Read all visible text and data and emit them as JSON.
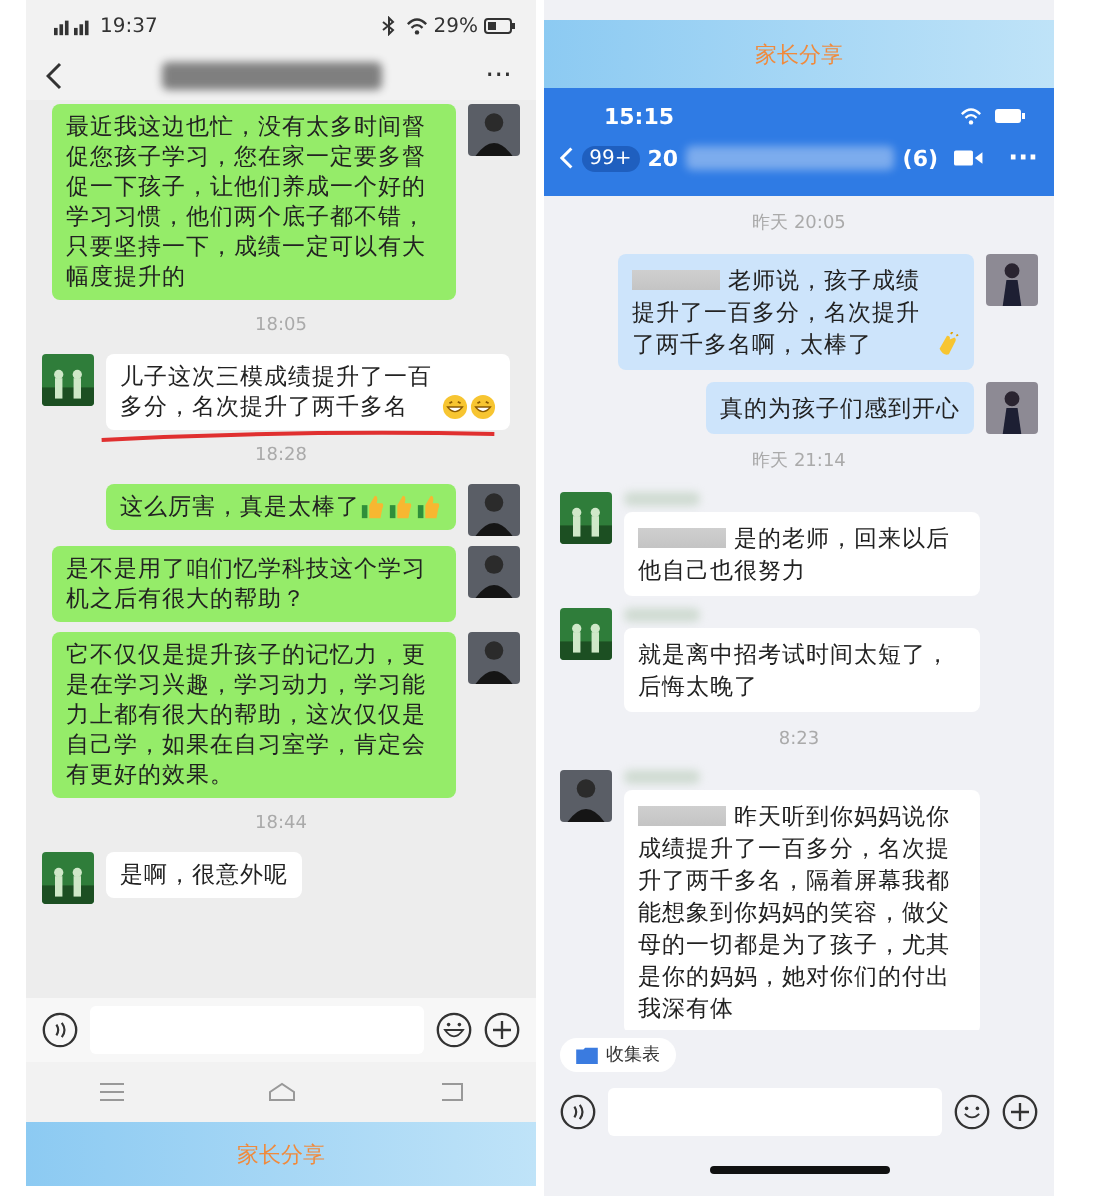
{
  "left_phone": {
    "status_bar": {
      "time": "19:37",
      "battery": "29%"
    },
    "header": {
      "more": "···"
    },
    "messages": [
      {
        "kind": "message",
        "outgoing": true,
        "avatar": {
          "kind": "suit"
        },
        "text": "最近我这边也忙，没有太多时间督促您孩子学习，您在家一定要多督促一下孩子，让他们养成一个好的学习习惯，他们两个底子都不错，只要坚持一下，成绩一定可以有大幅度提升的",
        "highlighted": false
      },
      {
        "kind": "time",
        "text": "18:05"
      },
      {
        "kind": "message",
        "outgoing": false,
        "avatar": {
          "kind": "scenery"
        },
        "text": "儿子这次三模成绩提升了一百多分，名次提升了两千多名",
        "emojis": [
          {
            "kind": "grin"
          },
          {
            "kind": "grin"
          }
        ],
        "highlighted": true
      },
      {
        "kind": "time",
        "text": "18:28"
      },
      {
        "kind": "message",
        "outgoing": true,
        "avatar": {
          "kind": "suit"
        },
        "text": "这么厉害，真是太棒了",
        "emojis": [
          {
            "kind": "thumbs-up"
          },
          {
            "kind": "thumbs-up"
          },
          {
            "kind": "thumbs-up"
          }
        ],
        "highlighted": false
      },
      {
        "kind": "message",
        "outgoing": true,
        "avatar": {
          "kind": "suit"
        },
        "text": "是不是用了咱们忆学科技这个学习机之后有很大的帮助？",
        "highlighted": false
      },
      {
        "kind": "message",
        "outgoing": true,
        "avatar": {
          "kind": "suit"
        },
        "text": "它不仅仅是提升孩子的记忆力，更是在学习兴趣，学习动力，学习能力上都有很大的帮助，这次仅仅是自己学，如果在自习室学，肯定会有更好的效果。",
        "highlighted": false
      },
      {
        "kind": "time",
        "text": "18:44"
      },
      {
        "kind": "message",
        "outgoing": false,
        "avatar": {
          "kind": "scenery"
        },
        "text": "是啊，很意外呢",
        "highlighted": false
      }
    ],
    "banner": "家长分享"
  },
  "right_phone": {
    "banner": "家长分享",
    "status_bar": {
      "time": "15:15"
    },
    "header": {
      "unread": "99+",
      "title": "20",
      "member_count": "(6)",
      "more": "···"
    },
    "messages": [
      {
        "kind": "time",
        "text": "昨天 20:05"
      },
      {
        "kind": "message",
        "outgoing": true,
        "avatar": {
          "kind": "woman"
        },
        "sender_blurred": false,
        "blurred_prefix": true,
        "text": "老师说，孩子成绩提升了一百多分，名次提升了两千多名啊，太棒了",
        "emojis": [
          {
            "kind": "clap"
          }
        ]
      },
      {
        "kind": "message",
        "outgoing": true,
        "avatar": {
          "kind": "woman"
        },
        "sender_blurred": false,
        "blurred_prefix": false,
        "text": "真的为孩子们感到开心"
      },
      {
        "kind": "time",
        "text": "昨天 21:14"
      },
      {
        "kind": "message",
        "outgoing": false,
        "avatar": {
          "kind": "scenery"
        },
        "sender_blurred": true,
        "blurred_prefix": true,
        "text": "是的老师，回来以后他自己也很努力"
      },
      {
        "kind": "message",
        "outgoing": false,
        "avatar": {
          "kind": "scenery"
        },
        "sender_blurred": true,
        "blurred_prefix": false,
        "text": "就是离中招考试时间太短了，后悔太晚了"
      },
      {
        "kind": "time",
        "text": "8:23"
      },
      {
        "kind": "message",
        "outgoing": false,
        "avatar": {
          "kind": "suit"
        },
        "sender_blurred": true,
        "blurred_prefix": true,
        "text": "昨天听到你妈妈说你成绩提升了一百多分，名次提升了两千多名，隔着屏幕我都能想象到你妈妈的笑容，做父母的一切都是为了孩子，尤其是你的妈妈，她对你们的付出我深有体"
      }
    ],
    "chip": "收集表"
  }
}
